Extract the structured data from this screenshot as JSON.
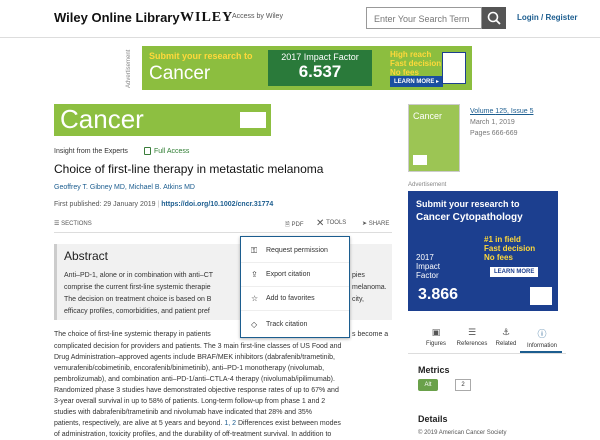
{
  "header": {
    "brand": "Wiley Online Library",
    "wiley": "WILEY",
    "access": "Access by Wiley",
    "search_placeholder": "Enter Your Search Term",
    "login": "Login / Register"
  },
  "top_ad": {
    "label": "Advertisement",
    "submit": "Submit your research to",
    "journal": "Cancer",
    "impact_label": "2017 Impact Factor",
    "impact_value": "6.537",
    "reach": [
      "High reach",
      "Fast decision",
      "No fees"
    ],
    "learn": "LEARN MORE ▸"
  },
  "journal": {
    "name": "Cancer"
  },
  "article": {
    "type": "Insight from the Experts",
    "access": "Full Access",
    "title": "Choice of first-line therapy in metastatic melanoma",
    "authors": "Geoffrey T. Gibney MD,   Michael B. Atkins MD",
    "first_published": "First published: 29 January 2019",
    "doi": "https://doi.org/10.1002/cncr.31774"
  },
  "toolbar": {
    "sections": "SECTIONS",
    "pdf": "PDF",
    "tools": "TOOLS",
    "share": "SHARE"
  },
  "tools_menu": [
    {
      "label": "Request permission",
      "icon": "key-icon",
      "glyph": "⚿"
    },
    {
      "label": "Export citation",
      "icon": "export-icon",
      "glyph": "⇪"
    },
    {
      "label": "Add to favorites",
      "icon": "star-icon",
      "glyph": "☆"
    },
    {
      "label": "Track citation",
      "icon": "track-icon",
      "glyph": "◇"
    }
  ],
  "abstract": {
    "heading": "Abstract",
    "lines": [
      "Anti–PD-1, alone or in combination with anti–CT",
      "comprise the current first-line systemic therapie",
      "The decision on treatment choice is based on B",
      "efficacy profiles, comorbidities, and patient pref"
    ],
    "lines_right": [
      "pies",
      "melanoma.",
      "city,",
      ""
    ]
  },
  "body": {
    "lines": [
      "The choice of first-line systemic therapy in patients",
      "complicated decision for providers and patients. The 3 main first-line classes of US Food and",
      "Drug Administration–approved agents include BRAF/MEK inhibitors (dabrafenib/trametinib,",
      "vemurafenib/cobimetinib, encorafenib/binimetinib), anti–PD-1 monotherapy (nivolumab,",
      "pembrolizumab), and combination anti–PD-1/anti–CTLA-4 therapy (nivolumab/ipilimumab).",
      "Randomized phase 3 studies have demonstrated objective response rates of up to 67% and",
      "3-year overall survival in up to 58% of patients. Long-term follow-up from phase 1 and 2",
      "studies with dabrafenib/trametinib and nivolumab have indicated that 28% and 35%",
      "patients, respectively, are alive at 5 years and beyond.",
      "of administration, toxicity profiles, and the durability of off-treatment survival. In addition to"
    ],
    "line0_right": "s become a",
    "line8_refs": "1, 2",
    "line8_tail": " Differences exist between modes"
  },
  "sidebar": {
    "cover_name": "Cancer",
    "volume_prefix": "Volume ",
    "volume": "125",
    "issue_prefix": ", Issue ",
    "issue": "5",
    "date": "March 1, 2019",
    "pages": "Pages 666-669",
    "ad_label": "Advertisement",
    "ad": {
      "line1": "Submit your research to",
      "line2": "Cancer Cytopathology",
      "focus": [
        "#1 in field",
        "Fast decision",
        "No fees"
      ],
      "if_label": [
        "2017",
        "Impact",
        "Factor"
      ],
      "if_value": "3.866",
      "learn": "LEARN MORE"
    },
    "tabs": [
      {
        "label": "Figures",
        "glyph": "▣"
      },
      {
        "label": "References",
        "glyph": "☰"
      },
      {
        "label": "Related",
        "glyph": "⚓"
      },
      {
        "label": "Information",
        "glyph": "ⓘ"
      }
    ],
    "metrics": "Metrics",
    "altmetric": "Alt",
    "score": "2",
    "details": "Details",
    "copyright": "© 2019 American Cancer Society"
  }
}
